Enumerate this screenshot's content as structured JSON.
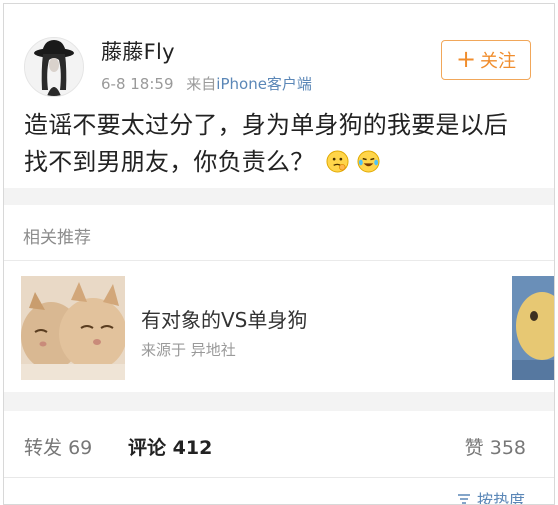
{
  "post": {
    "username": "藤藤Fly",
    "date": "6-8 18:59",
    "source_prefix": "来自",
    "source_link": "iPhone客户端",
    "follow_label": "关注",
    "text_line1": "造谣不要太过分了，身为单身狗的我要是以后",
    "text_line2": "找不到男朋友，你负责么？"
  },
  "related": {
    "title": "相关推荐",
    "card": {
      "title": "有对象的VS单身狗",
      "source": "来源于 异地社"
    }
  },
  "tabs": {
    "repost_label": "转发",
    "repost_count": "69",
    "comment_label": "评论",
    "comment_count": "412",
    "like_label": "赞",
    "like_count": "358"
  },
  "sort": {
    "label": "按热度"
  },
  "colors": {
    "accent_orange": "#f08d2d",
    "link_blue": "#5b87b7",
    "gray_text": "#9a9a9a"
  }
}
